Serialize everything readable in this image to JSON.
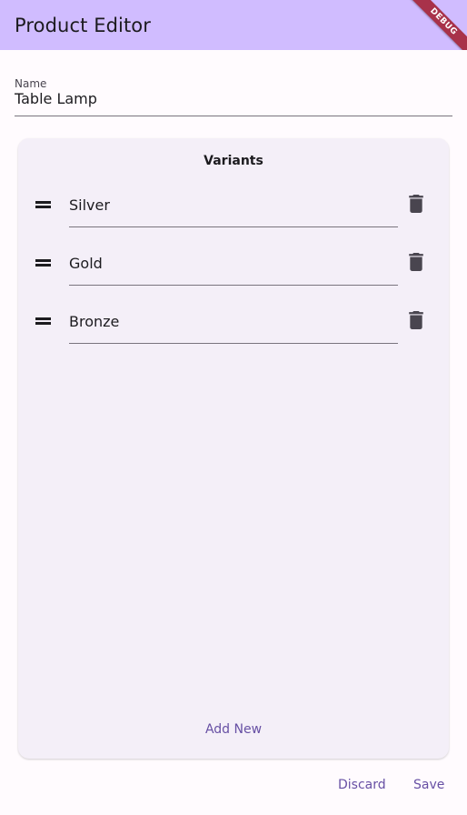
{
  "app_bar": {
    "title": "Product Editor",
    "debug_label": "DEBUG"
  },
  "name_field": {
    "label": "Name",
    "value": "Table Lamp"
  },
  "variants": {
    "title": "Variants",
    "items": [
      {
        "value": "Silver"
      },
      {
        "value": "Gold"
      },
      {
        "value": "Bronze"
      }
    ],
    "add_new_label": "Add New"
  },
  "actions": {
    "discard_label": "Discard",
    "save_label": "Save"
  },
  "colors": {
    "app_bar": "#d0bcff",
    "accent": "#6750a4",
    "card": "#f4eff8",
    "debug_banner": "#a8324a"
  },
  "icons": {
    "drag": "drag-handle-icon",
    "delete": "trash-icon"
  }
}
